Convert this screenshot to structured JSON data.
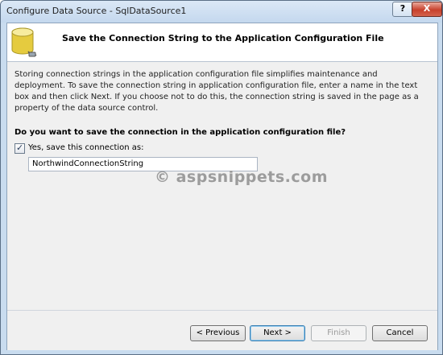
{
  "window": {
    "title": "Configure Data Source - SqlDataSource1",
    "help_label": "?",
    "close_label": "X"
  },
  "header": {
    "title": "Save the Connection String to the Application Configuration File",
    "icon": "database-connection-icon"
  },
  "main": {
    "description": "Storing connection strings in the application configuration file simplifies maintenance and deployment. To save the connection string in application configuration file, enter a name in the text box and then click Next. If you choose not to do this, the connection string is saved in the page as a property of the data source control.",
    "question": "Do you want to save the connection in the application configuration file?",
    "save_checkbox": {
      "label": "Yes, save this connection as:",
      "checked": true,
      "check_glyph": "✓"
    },
    "connection_name_value": "NorthwindConnectionString",
    "watermark": "© aspsnippets.com"
  },
  "footer": {
    "previous_label": "< Previous",
    "next_label": "Next >",
    "finish_label": "Finish",
    "cancel_label": "Cancel"
  }
}
